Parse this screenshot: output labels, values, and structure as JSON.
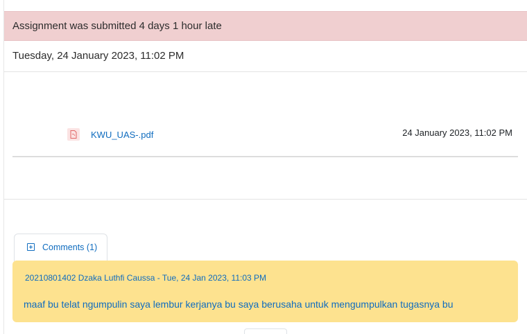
{
  "submission": {
    "status_text": "Assignment was submitted 4 days 1 hour late",
    "last_modified": "Tuesday, 24 January 2023, 11:02 PM"
  },
  "file": {
    "icon": "pdf-file-icon",
    "name": "KWU_UAS-.pdf",
    "date": "24 January 2023, 11:02 PM"
  },
  "comments": {
    "toggle_icon": "expand-plus-icon",
    "label": "Comments (1)",
    "items": [
      {
        "meta": "20210801402 Dzaka Luthfi Caussa  - Tue, 24 Jan 2023, 11:03 PM",
        "text": "maaf bu telat ngumpulin saya lembur kerjanya bu saya berusaha untuk mengumpulkan tugasnya bu"
      }
    ]
  },
  "colors": {
    "late_status_bg": "#f0cfd0",
    "link": "#0f6cbf",
    "comment_bg": "#fde28f"
  }
}
